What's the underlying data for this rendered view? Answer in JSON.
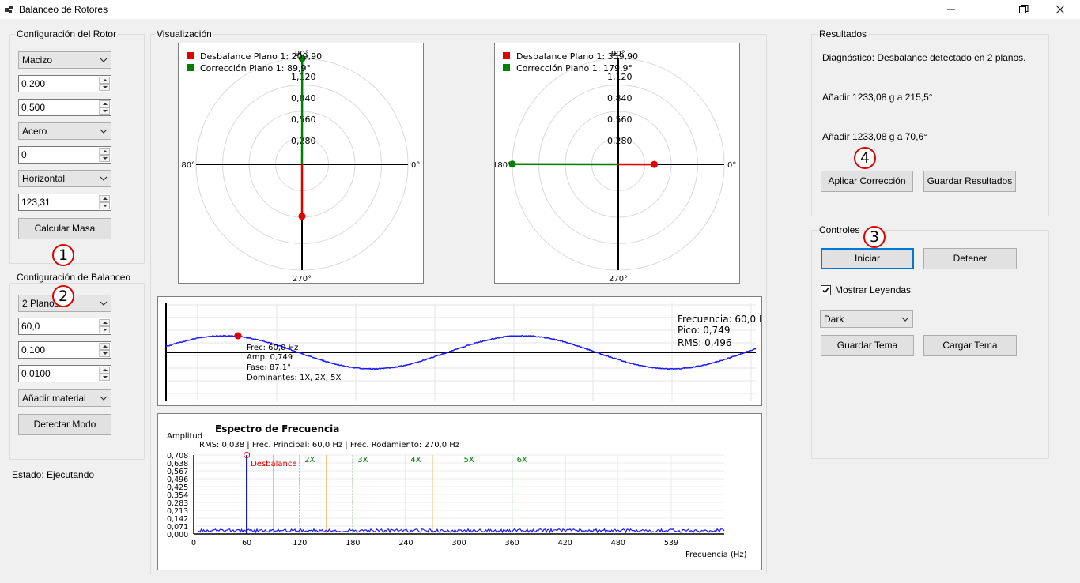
{
  "window": {
    "title": "Balanceo de Rotores"
  },
  "rotor_config": {
    "title": "Configuración del Rotor",
    "type_value": "Macizo",
    "field1_value": "0,200",
    "field2_value": "0,500",
    "material_value": "Acero",
    "field3_value": "0",
    "orientation_value": "Horizontal",
    "field4_value": "123,31",
    "calc_button": "Calcular Masa",
    "marker": "1"
  },
  "balance_config": {
    "title": "Configuración de Balanceo",
    "planes_value": "2 Planos",
    "marker": "2",
    "field1_value": "60,0",
    "field2_value": "0,100",
    "field3_value": "0,0100",
    "method_value": "Añadir material",
    "detect_button": "Detectar Modo"
  },
  "status": {
    "text": "Estado: Ejecutando"
  },
  "visualization": {
    "title": "Visualización",
    "polar1": {
      "legend_unbalance": "Desbalance Plano 1: 209,90",
      "legend_correction": "Corrección Plano 1: 89,9°",
      "ring_labels": [
        "0,280",
        "0,560",
        "0,840",
        "1,120"
      ],
      "angle_0": "0°",
      "angle_90": "90°",
      "angle_180": "180°",
      "angle_270": "270°",
      "unbalance_angle_deg": 270,
      "unbalance_magnitude": 0.49,
      "correction_angle_deg": 89.9,
      "correction_magnitude": 1.0
    },
    "polar2": {
      "legend_unbalance": "Desbalance Plano 1: 359,90",
      "legend_correction": "Corrección Plano 1: 179,9°",
      "ring_labels": [
        "0,280",
        "0,560",
        "0,840",
        "1,120"
      ],
      "angle_0": "0°",
      "angle_90": "90°",
      "angle_180": "180°",
      "angle_270": "270°",
      "unbalance_angle_deg": 359.9,
      "unbalance_magnitude": 0.34,
      "correction_angle_deg": 179.9,
      "correction_magnitude": 1.0
    },
    "wave": {
      "info_freq": "Frecuencia: 60,0 H",
      "info_peak": "Pico: 0,749",
      "info_rms": "RMS: 0,496",
      "tip_freq": "Frec: 60,0 Hz",
      "tip_amp": "Amp: 0,749",
      "tip_phase": "Fase: 87,1°",
      "tip_dominant": "Dominantes: 1X, 2X, 5X"
    },
    "spectrum": {
      "title": "Espectro de Frecuencia",
      "ylabel": "Amplitud",
      "subtitle": "RMS: 0,038 | Frec. Principal: 60,0 Hz | Frec. Rodamiento: 270,0 Hz",
      "xlabel": "Frecuencia (Hz)",
      "unbalance_label": "Desbalance",
      "harmonic_labels": [
        "2X",
        "3X",
        "4X",
        "5X",
        "6X"
      ],
      "x_ticks": [
        "0",
        "60",
        "120",
        "180",
        "240",
        "300",
        "360",
        "420",
        "480",
        "539"
      ],
      "y_ticks": [
        "0,708",
        "0,638",
        "0,567",
        "0,496",
        "0,425",
        "0,354",
        "0,283",
        "0,213",
        "0,142",
        "0,071",
        "0,000"
      ]
    }
  },
  "chart_data": [
    {
      "type": "line",
      "title": "",
      "series": [
        {
          "name": "",
          "amplitude": 0.749,
          "frequency_hz": 60.0,
          "phase_deg": 87.1
        }
      ],
      "highlight_point": {
        "label": "Frec: 60,0 Hz"
      }
    },
    {
      "type": "bar",
      "title": "Espectro de Frecuencia",
      "xlabel": "Frecuencia (Hz)",
      "ylabel": "Amplitud",
      "xlim": [
        0,
        600
      ],
      "ylim": [
        0,
        0.708
      ],
      "peaks": [
        {
          "x": 60,
          "y": 0.708,
          "label": "Desbalance"
        }
      ],
      "harmonics": [
        120,
        180,
        240,
        300,
        360
      ],
      "bearing_lines": [
        90,
        150,
        270,
        420
      ],
      "noise_level": 0.03
    }
  ],
  "results": {
    "title": "Resultados",
    "diagnosis": "Diagnóstico: Desbalance detectado en 2 planos.",
    "plane1": "Añadir 1233,08 g a 215,5°",
    "plane2": "Añadir 1233,08 g a 70,6°",
    "marker": "4",
    "apply_button": "Aplicar Corrección",
    "save_button": "Guardar Resultados"
  },
  "controls": {
    "title": "Controles",
    "marker": "3",
    "start_button": "Iniciar",
    "stop_button": "Detener",
    "show_legends_label": "Mostrar Leyendas",
    "show_legends_checked": true,
    "theme_value": "Dark",
    "save_theme_button": "Guardar Tema",
    "load_theme_button": "Cargar Tema"
  },
  "colors": {
    "unbalance": "#e00000",
    "correction": "#008000",
    "wave": "#1a1aff",
    "focus": "#0078d7"
  }
}
